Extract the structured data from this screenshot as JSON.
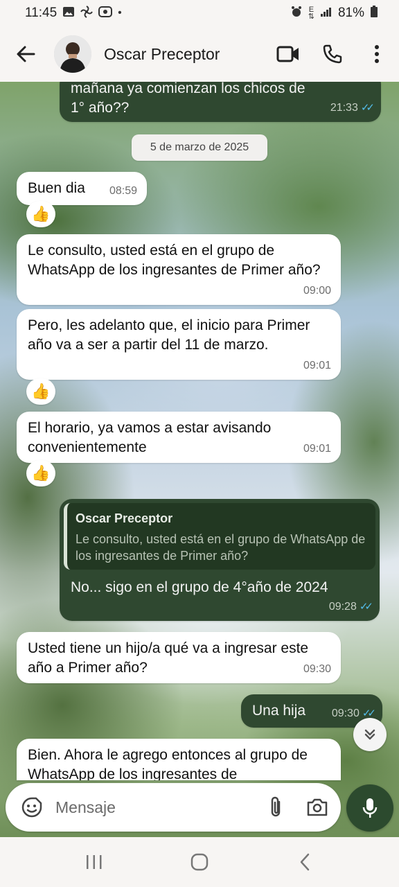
{
  "status_bar": {
    "time": "11:45",
    "dot": "•",
    "battery": "81%",
    "network_letter": "E",
    "left_icons": [
      "image-icon",
      "pinwheel-icon",
      "media-icon"
    ],
    "right_icons": [
      "alarm-icon",
      "data-icon",
      "signal-icon",
      "battery-icon"
    ]
  },
  "header": {
    "contact_name": "Oscar Preceptor",
    "icons": [
      "back-arrow-icon",
      "avatar",
      "video-call-icon",
      "phone-call-icon",
      "more-vert-icon"
    ]
  },
  "chat": {
    "messages": [
      {
        "id": "m0",
        "direction": "out",
        "text": "mañana ya comienzan los chicos de 1° año??",
        "time": "21:33",
        "status": "read"
      },
      {
        "id": "m1",
        "direction": "in",
        "text": "Buen dia",
        "time": "08:59",
        "reaction": "👍"
      },
      {
        "id": "m2",
        "direction": "in",
        "text": "Le consulto, usted está en el grupo de WhatsApp de los ingresantes de Primer año?",
        "time": "09:00"
      },
      {
        "id": "m3",
        "direction": "in",
        "text": "Pero, les adelanto que, el inicio para Primer año va a ser a partir del 11 de marzo.",
        "time": "09:01",
        "reaction": "👍"
      },
      {
        "id": "m4",
        "direction": "in",
        "text": "El horario, ya vamos a estar avisando convenientemente",
        "time": "09:01",
        "reaction": "👍"
      },
      {
        "id": "m5",
        "direction": "out",
        "quote_name": "Oscar Preceptor",
        "quote_text": "Le consulto, usted está en el grupo de WhatsApp de los ingresantes de Primer año?",
        "text": "No... sigo en el grupo de 4°año de 2024",
        "time": "09:28",
        "status": "read"
      },
      {
        "id": "m6",
        "direction": "in",
        "text": "Usted tiene un hijo/a qué va a ingresar este año a Primer año?",
        "time": "09:30"
      },
      {
        "id": "m7",
        "direction": "out",
        "text": "Una hija",
        "time": "09:30",
        "status": "read"
      },
      {
        "id": "m8",
        "direction": "in",
        "text": "Bien. Ahora le agrego entonces al grupo de WhatsApp de los ingresantes de"
      }
    ],
    "date_separator": "5 de marzo de 2025",
    "read_ticks": "✓✓"
  },
  "input": {
    "placeholder": "Mensaje",
    "icons": [
      "emoji-icon",
      "attach-icon",
      "camera-icon",
      "mic-icon"
    ]
  },
  "nav_bar": {
    "buttons": [
      "recents-icon",
      "home-icon",
      "back-icon"
    ]
  },
  "colors": {
    "outgoing_bubble": "#2f4830",
    "incoming_bubble": "#ffffff",
    "read_ticks": "#53bdeb",
    "mic_button": "#2c4a2e"
  }
}
